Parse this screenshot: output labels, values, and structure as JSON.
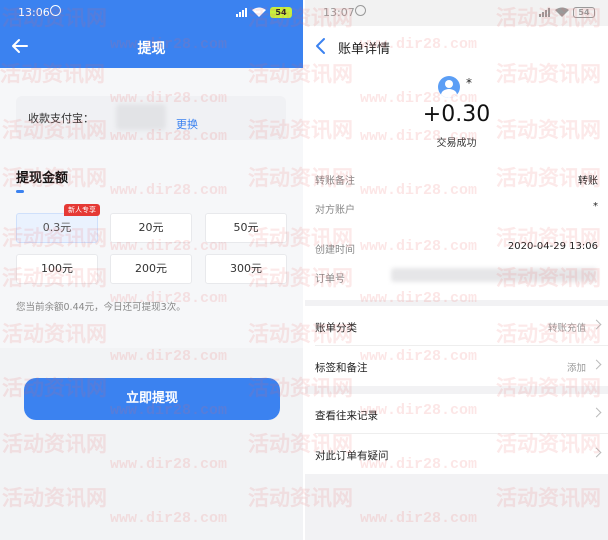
{
  "left": {
    "status_time": "13:06",
    "battery": "54",
    "title": "提现",
    "alipay_label": "收款支付宝：",
    "change_link": "更换",
    "section_title": "提现金额",
    "new_user_tag": "新人专享",
    "amounts": [
      "0.3元",
      "20元",
      "50元",
      "100元",
      "200元",
      "300元"
    ],
    "balance_note": "您当前余额0.44元，今日还可提现3次。",
    "submit_button": "立即提现"
  },
  "right": {
    "status_time": "13:07",
    "title": "账单详情",
    "payer_name": "*",
    "amount": "+0.30",
    "status": "交易成功",
    "details": [
      {
        "key": "转账备注",
        "value": "转账"
      },
      {
        "key": "对方账户",
        "value": "*"
      },
      {
        "key": "创建时间",
        "value": "2020-04-29 13:06"
      },
      {
        "key": "订单号",
        "value": ""
      }
    ],
    "rows": [
      {
        "key": "账单分类",
        "value": "转账充值"
      },
      {
        "key": "标签和备注",
        "value": "添加"
      },
      {
        "key": "查看往来记录",
        "value": ""
      },
      {
        "key": "对此订单有疑问",
        "value": ""
      }
    ]
  },
  "watermark": {
    "cn": "活动资讯网",
    "url": "www.dir28.com"
  },
  "colors": {
    "accent": "#3b82f0",
    "tag_red": "#e53935",
    "battery_green": "#c8f03c"
  }
}
